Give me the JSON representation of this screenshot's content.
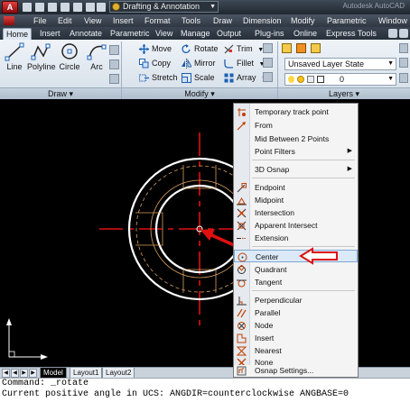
{
  "titlebar": {
    "app_letter": "A",
    "workspace": "Drafting & Annotation",
    "right_text": "Autodesk AutoCAD"
  },
  "menubar": {
    "items": [
      "File",
      "Edit",
      "View",
      "Insert",
      "Format",
      "Tools",
      "Draw",
      "Dimension",
      "Modify",
      "Parametric",
      "Window"
    ]
  },
  "ribbon_tabs": [
    "Home",
    "Insert",
    "Annotate",
    "Parametric",
    "View",
    "Manage",
    "Output",
    "Plug-ins",
    "Online",
    "Express Tools"
  ],
  "draw_panel": {
    "title": "Draw",
    "tools": [
      "Line",
      "Polyline",
      "Circle",
      "Arc"
    ]
  },
  "modify_panel": {
    "title": "Modify",
    "row1": [
      "Move",
      "Rotate",
      "Trim"
    ],
    "row2": [
      "Copy",
      "Mirror",
      "Fillet"
    ],
    "row3": [
      "Stretch",
      "Scale",
      "Array"
    ]
  },
  "layers_panel": {
    "title": "Layers",
    "layer_state": "Unsaved Layer State",
    "current_layer": "0"
  },
  "context_menu": {
    "items": [
      {
        "label": "Temporary track point",
        "icon": "track-point-icon"
      },
      {
        "label": "From",
        "icon": "from-icon"
      },
      {
        "label": "Mid Between 2 Points",
        "icon": ""
      },
      {
        "label": "Point Filters",
        "icon": "",
        "submenu": true
      },
      {
        "label": "3D Osnap",
        "icon": "",
        "submenu": true
      },
      {
        "label": "Endpoint",
        "icon": "endpoint-icon"
      },
      {
        "label": "Midpoint",
        "icon": "midpoint-icon"
      },
      {
        "label": "Intersection",
        "icon": "intersection-icon"
      },
      {
        "label": "Apparent Intersect",
        "icon": "apparent-intersect-icon"
      },
      {
        "label": "Extension",
        "icon": "extension-icon"
      },
      {
        "label": "Center",
        "icon": "center-icon",
        "highlighted": true
      },
      {
        "label": "Quadrant",
        "icon": "quadrant-icon"
      },
      {
        "label": "Tangent",
        "icon": "tangent-icon"
      },
      {
        "label": "Perpendicular",
        "icon": "perpendicular-icon"
      },
      {
        "label": "Parallel",
        "icon": "parallel-icon"
      },
      {
        "label": "Node",
        "icon": "node-icon"
      },
      {
        "label": "Insert",
        "icon": "insert-icon"
      },
      {
        "label": "Nearest",
        "icon": "nearest-icon"
      },
      {
        "label": "None",
        "icon": "none-icon"
      },
      {
        "label": "Osnap Settings...",
        "icon": "osnap-settings-icon"
      }
    ]
  },
  "layout_tabs": [
    "Model",
    "Layout1",
    "Layout2"
  ],
  "command_line": {
    "line1": "Command: _rotate",
    "line2": "Current positive angle in UCS:  ANGDIR=counterclockwise  ANGBASE=0"
  },
  "colors": {
    "accent_red": "#e01010",
    "highlight": "#dbe9f8",
    "drawing_bg": "#000000",
    "object_color": "#d8a060"
  }
}
